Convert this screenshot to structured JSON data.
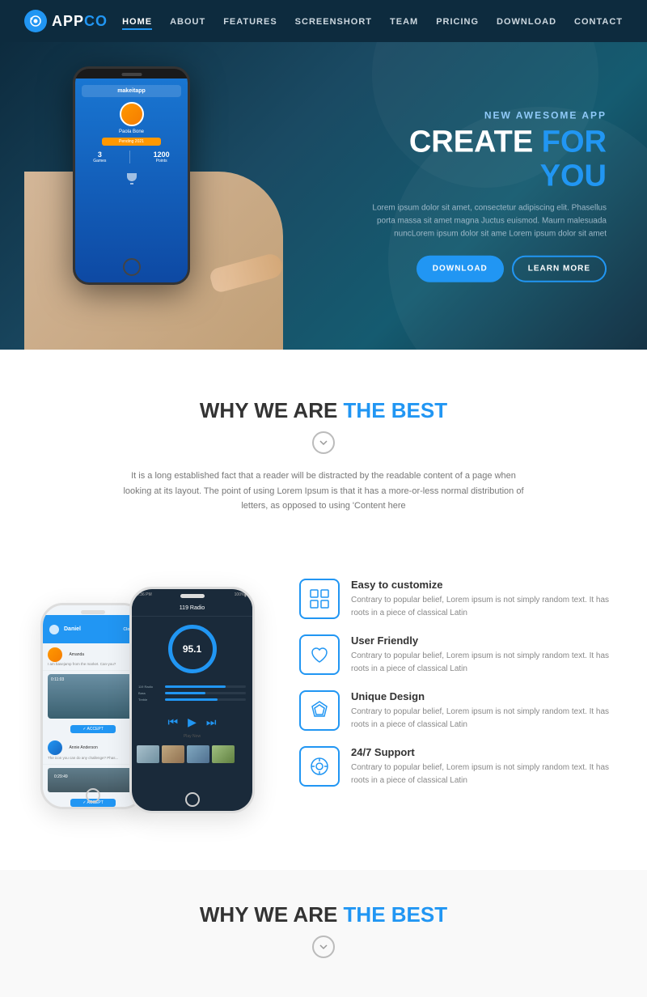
{
  "brand": {
    "name_part1": "APP",
    "name_part2": "CO",
    "icon_text": "●"
  },
  "nav": {
    "items": [
      {
        "label": "HOME",
        "active": true
      },
      {
        "label": "ABOUT",
        "active": false
      },
      {
        "label": "FEATURES",
        "active": false
      },
      {
        "label": "SCREENSHORT",
        "active": false
      },
      {
        "label": "TEAM",
        "active": false
      },
      {
        "label": "PRICING",
        "active": false
      },
      {
        "label": "DOWNLOAD",
        "active": false
      },
      {
        "label": "CONTACT",
        "active": false
      }
    ]
  },
  "hero": {
    "subtitle": "NEW AWESOME APP",
    "title_part1": "CREATE ",
    "title_part2": "FOR YOU",
    "description": "Lorem ipsum dolor sit amet, consectetur adipiscing elit. Phasellus porta massa sit amet magna Juctus euismod. Maurn malesuada nuncLorem ipsum dolor sit ame Lorem ipsum dolor sit amet",
    "btn_download": "DOWNLOAD",
    "btn_learn": "LEARN MORE"
  },
  "why_section": {
    "title_part1": "WHY WE ARE ",
    "title_part2": "THE BEST",
    "description": "It is a long established fact that a reader will be distracted by the readable content of a page when looking at its layout. The point of using Lorem Ipsum is that it has a more-or-less normal distribution of letters, as opposed to using 'Content here"
  },
  "features": [
    {
      "icon": "⊞",
      "title": "Easy to customize",
      "description": "Contrary to popular belief, Lorem ipsum is not simply random text. It has roots in a piece of classical Latin"
    },
    {
      "icon": "♡",
      "title": "User Friendly",
      "description": "Contrary to popular belief, Lorem ipsum is not simply random text. It has roots in a piece of classical Latin"
    },
    {
      "icon": "◇",
      "title": "Unique Design",
      "description": "Contrary to popular belief, Lorem ipsum is not simply random text. It has roots in a piece of classical Latin"
    },
    {
      "icon": "⊙",
      "title": "24/7 Support",
      "description": "Contrary to popular belief, Lorem ipsum is not simply random text. It has roots in a piece of classical Latin"
    }
  ],
  "why_section_2": {
    "title_part1": "WHY WE ARE ",
    "title_part2": "THE BEST"
  },
  "phone_app": {
    "header": "makeitapp",
    "name": "Paola Bone",
    "btn": "Pending 2021",
    "stat1_num": "3",
    "stat1_label": "Games",
    "stat2_num": "1200",
    "stat2_label": "Points"
  },
  "mock_gauge_value": "95.1",
  "chat_items": [
    {
      "name": "Amanda",
      "msg": "Can-you?"
    },
    {
      "name": "Annie Anderson",
      "msg": "The icon you can do any challenge? Phas..."
    }
  ],
  "bars": [
    {
      "label": "119 Radio",
      "pct": 75
    },
    {
      "label": "Bass",
      "pct": 50
    },
    {
      "label": "Treble",
      "pct": 65
    }
  ]
}
